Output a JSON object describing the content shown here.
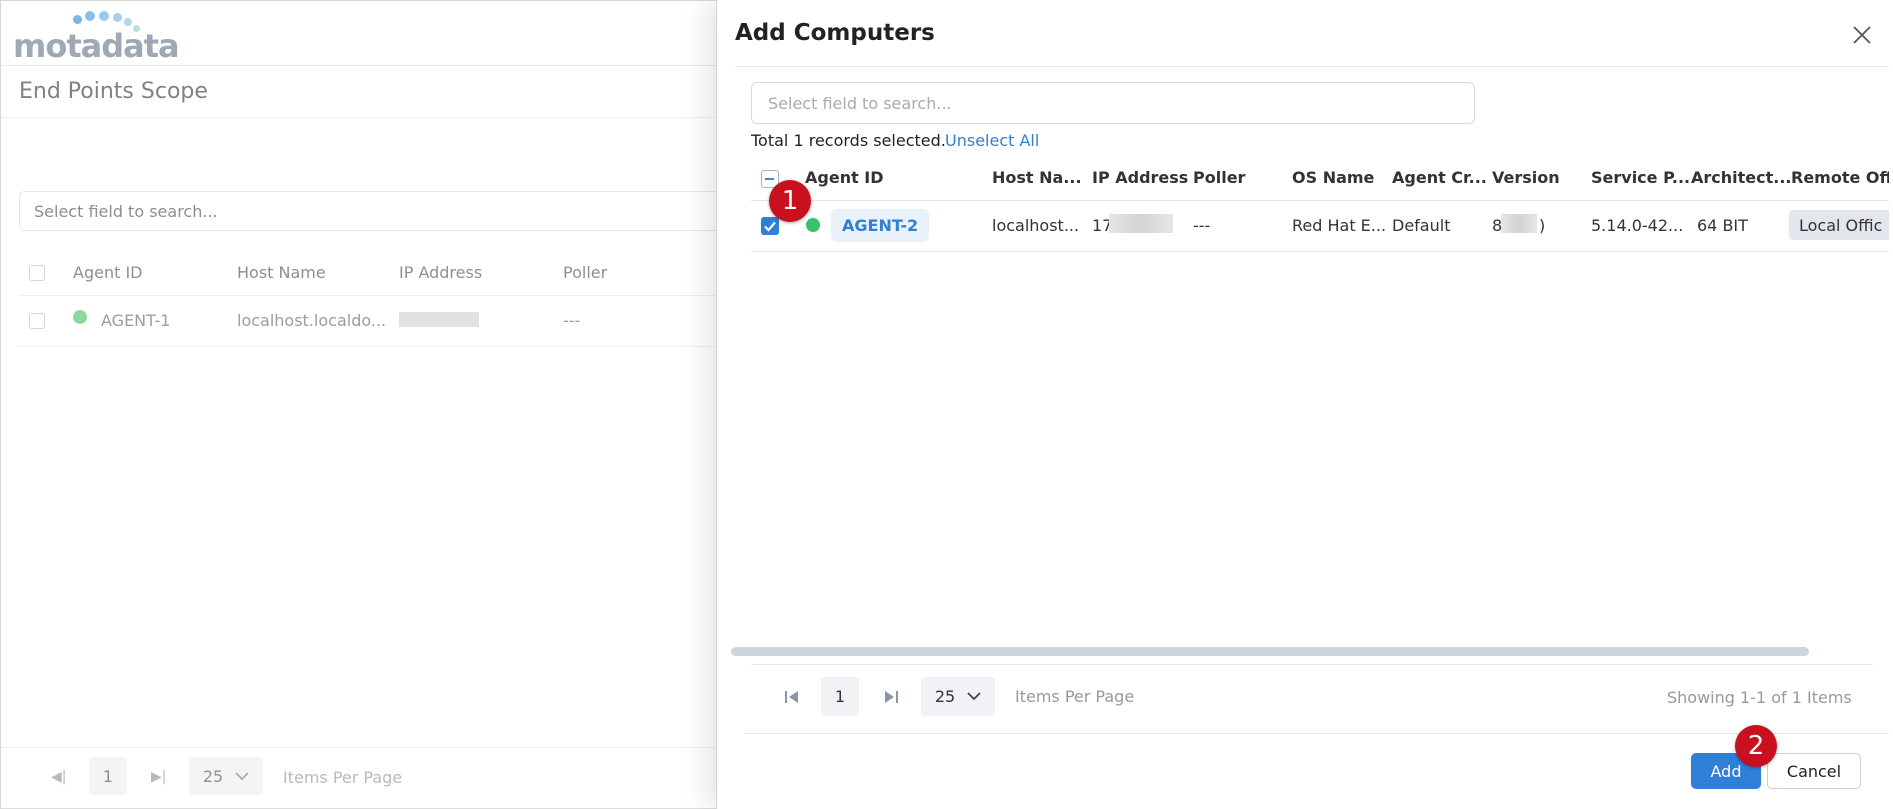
{
  "background": {
    "logo_text": "motadata",
    "page_title": "End Points Scope",
    "search_placeholder": "Select field to search...",
    "columns": [
      "Agent ID",
      "Host Name",
      "IP Address",
      "Poller"
    ],
    "row": {
      "agent_id": "AGENT-1",
      "host_name": "localhost.localdo...",
      "poller": "---"
    },
    "pager": {
      "page": "1",
      "per_page": "25",
      "items_per_page_label": "Items Per Page"
    }
  },
  "drawer": {
    "title": "Add Computers",
    "search_placeholder": "Select field to search...",
    "selection_summary": "Total 1 records selected.",
    "unselect_all": "Unselect All",
    "columns": [
      "Agent ID",
      "Host Na...",
      "IP Address",
      "Poller",
      "OS Name",
      "Agent Cr...",
      "Version",
      "Service P...",
      "Architect...",
      "Remote Offi"
    ],
    "rows": [
      {
        "agent_id": "AGENT-2",
        "status_color": "#36c26a",
        "host_name": "localhost...",
        "ip_address": "17",
        "poller": "---",
        "os_name": "Red Hat E...",
        "agent_credential": "Default",
        "version_start": "8",
        "version_end": ")",
        "service_pack": "5.14.0-42...",
        "architecture": "64 BIT",
        "remote_office": "Local Offic"
      }
    ],
    "pager": {
      "page": "1",
      "per_page": "25",
      "items_per_page_label": "Items Per Page",
      "showing": "Showing 1-1 of 1 Items"
    },
    "add_label": "Add",
    "cancel_label": "Cancel"
  },
  "annotations": {
    "step_1": "1",
    "step_2": "2",
    "badge_color": "#c8101e"
  },
  "colors": {
    "accent": "#2f7fd8",
    "link": "#2f80d1",
    "status_online": "#36c26a"
  }
}
